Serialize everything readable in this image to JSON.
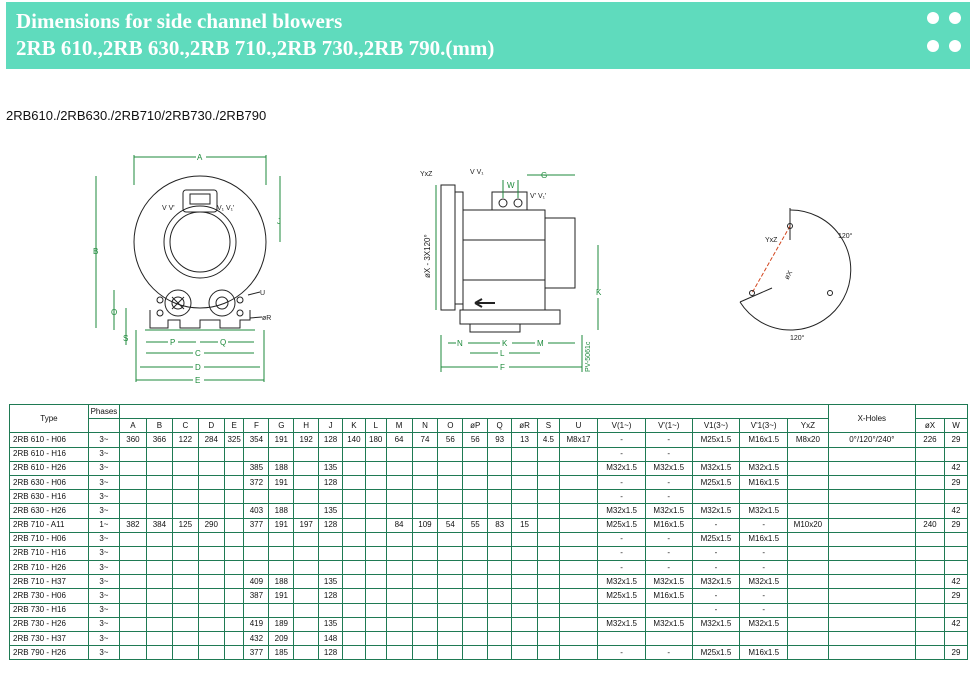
{
  "banner": {
    "title_line1": "Dimensions for side channel blowers",
    "title_line2": "2RB 610.,2RB 630.,2RB 710.,2RB 730.,2RB 790.(mm)",
    "accent_color": "#5fdbbd"
  },
  "subtitle": "2RB610./2RB630./2RB710/2RB730./2RB790",
  "drawing_labels": {
    "front": {
      "A": "A",
      "B": "B",
      "C": "C",
      "D": "D",
      "E": "E",
      "J": "J",
      "O": "O",
      "S": "S",
      "P": "P",
      "Q": "Q",
      "U": "U",
      "R": "øR",
      "V_left": "V V'",
      "V_right": "V₁ V₁'"
    },
    "side": {
      "YxZ": "YxZ",
      "VV1": "V V₁",
      "W": "W",
      "G": "G",
      "V1": "V' V₁'",
      "phiX": "øX - 3X120°",
      "K": "K",
      "N": "N",
      "L": "L",
      "M": "M",
      "F": "F",
      "PV": "PV-5061c"
    },
    "holes": {
      "YxZ": "YxZ",
      "deg_top": "120°",
      "deg_bottom": "120°",
      "phiX": "øX"
    }
  },
  "table": {
    "header": {
      "type": "Type",
      "phases": "Phases",
      "xholes": "X-Holes",
      "dims": [
        "A",
        "B",
        "C",
        "D",
        "E",
        "F",
        "G",
        "H",
        "J",
        "K",
        "L",
        "M",
        "N",
        "O",
        "øP",
        "Q",
        "øR",
        "S",
        "U",
        "V(1~)",
        "V'(1~)",
        "V1(3~)",
        "V'1(3~)",
        "YxZ"
      ],
      "phix": "øX",
      "w": "W"
    },
    "rows": [
      {
        "type": "2RB 610 - H06",
        "ph": "3~",
        "d": [
          "360",
          "366",
          "122",
          "284",
          "325",
          "354",
          "191",
          "192",
          "128",
          "140",
          "180",
          "64",
          "74",
          "56",
          "56",
          "93",
          "13",
          "4.5",
          "M8x17",
          "-",
          "-",
          "M25x1.5",
          "M16x1.5",
          "M8x20"
        ],
        "xh": "0°/120°/240°",
        "phix": "226",
        "w": "29"
      },
      {
        "type": "2RB 610 - H16",
        "ph": "3~",
        "d": [
          "",
          "",
          "",
          "",
          "",
          "",
          "",
          "",
          "",
          "",
          "",
          "",
          "",
          "",
          "",
          "",
          "",
          "",
          "",
          "-",
          "-",
          "",
          "",
          ""
        ],
        "xh": "",
        "phix": "",
        "w": ""
      },
      {
        "type": "2RB 610 - H26",
        "ph": "3~",
        "d": [
          "",
          "",
          "",
          "",
          "",
          "385",
          "188",
          "",
          "135",
          "",
          "",
          "",
          "",
          "",
          "",
          "",
          "",
          "",
          "",
          "M32x1.5",
          "M32x1.5",
          "M32x1.5",
          "M32x1.5",
          ""
        ],
        "xh": "",
        "phix": "",
        "w": "42"
      },
      {
        "type": "2RB 630 - H06",
        "ph": "3~",
        "d": [
          "",
          "",
          "",
          "",
          "",
          "372",
          "191",
          "",
          "128",
          "",
          "",
          "",
          "",
          "",
          "",
          "",
          "",
          "",
          "",
          "-",
          "-",
          "M25x1.5",
          "M16x1.5",
          ""
        ],
        "xh": "",
        "phix": "",
        "w": "29"
      },
      {
        "type": "2RB 630 - H16",
        "ph": "3~",
        "d": [
          "",
          "",
          "",
          "",
          "",
          "",
          "",
          "",
          "",
          "",
          "",
          "",
          "",
          "",
          "",
          "",
          "",
          "",
          "",
          "-",
          "-",
          "",
          "",
          ""
        ],
        "xh": "",
        "phix": "",
        "w": ""
      },
      {
        "type": "2RB 630 - H26",
        "ph": "3~",
        "d": [
          "",
          "",
          "",
          "",
          "",
          "403",
          "188",
          "",
          "135",
          "",
          "",
          "",
          "",
          "",
          "",
          "",
          "",
          "",
          "",
          "M32x1.5",
          "M32x1.5",
          "M32x1.5",
          "M32x1.5",
          ""
        ],
        "xh": "",
        "phix": "",
        "w": "42"
      },
      {
        "type": "2RB 710 - A11",
        "ph": "1~",
        "d": [
          "382",
          "384",
          "125",
          "290",
          "",
          "377",
          "191",
          "197",
          "128",
          "",
          "",
          "84",
          "109",
          "54",
          "55",
          "83",
          "15",
          "",
          "",
          "M25x1.5",
          "M16x1.5",
          "-",
          "-",
          "M10x20"
        ],
        "xh": "",
        "phix": "240",
        "w": "29"
      },
      {
        "type": "2RB 710 - H06",
        "ph": "3~",
        "d": [
          "",
          "",
          "",
          "",
          "",
          "",
          "",
          "",
          "",
          "",
          "",
          "",
          "",
          "",
          "",
          "",
          "",
          "",
          "",
          "-",
          "-",
          "M25x1.5",
          "M16x1.5",
          ""
        ],
        "xh": "",
        "phix": "",
        "w": ""
      },
      {
        "type": "2RB 710 - H16",
        "ph": "3~",
        "d": [
          "",
          "",
          "",
          "",
          "",
          "",
          "",
          "",
          "",
          "",
          "",
          "",
          "",
          "",
          "",
          "",
          "",
          "",
          "",
          "-",
          "-",
          "-",
          "-",
          ""
        ],
        "xh": "",
        "phix": "",
        "w": ""
      },
      {
        "type": "2RB 710 - H26",
        "ph": "3~",
        "d": [
          "",
          "",
          "",
          "",
          "",
          "",
          "",
          "",
          "",
          "",
          "",
          "",
          "",
          "",
          "",
          "",
          "",
          "",
          "",
          "-",
          "-",
          "-",
          "-",
          ""
        ],
        "xh": "",
        "phix": "",
        "w": ""
      },
      {
        "type": "2RB 710 - H37",
        "ph": "3~",
        "d": [
          "",
          "",
          "",
          "",
          "",
          "409",
          "188",
          "",
          "135",
          "",
          "",
          "",
          "",
          "",
          "",
          "",
          "",
          "",
          "",
          "M32x1.5",
          "M32x1.5",
          "M32x1.5",
          "M32x1.5",
          ""
        ],
        "xh": "",
        "phix": "",
        "w": "42"
      },
      {
        "type": "2RB 730 - H06",
        "ph": "3~",
        "d": [
          "",
          "",
          "",
          "",
          "",
          "387",
          "191",
          "",
          "128",
          "",
          "",
          "",
          "",
          "",
          "",
          "",
          "",
          "",
          "",
          "M25x1.5",
          "M16x1.5",
          "-",
          "-",
          ""
        ],
        "xh": "",
        "phix": "",
        "w": "29"
      },
      {
        "type": "2RB 730 - H16",
        "ph": "3~",
        "d": [
          "",
          "",
          "",
          "",
          "",
          "",
          "",
          "",
          "",
          "",
          "",
          "",
          "",
          "",
          "",
          "",
          "",
          "",
          "",
          "",
          "",
          "-",
          "-",
          ""
        ],
        "xh": "",
        "phix": "",
        "w": ""
      },
      {
        "type": "2RB 730 - H26",
        "ph": "3~",
        "d": [
          "",
          "",
          "",
          "",
          "",
          "419",
          "189",
          "",
          "135",
          "",
          "",
          "",
          "",
          "",
          "",
          "",
          "",
          "",
          "",
          "M32x1.5",
          "M32x1.5",
          "M32x1.5",
          "M32x1.5",
          ""
        ],
        "xh": "",
        "phix": "",
        "w": "42"
      },
      {
        "type": "2RB 730 - H37",
        "ph": "3~",
        "d": [
          "",
          "",
          "",
          "",
          "",
          "432",
          "209",
          "",
          "148",
          "",
          "",
          "",
          "",
          "",
          "",
          "",
          "",
          "",
          "",
          "",
          "",
          "",
          "",
          ""
        ],
        "xh": "",
        "phix": "",
        "w": ""
      },
      {
        "type": "2RB 790 - H26",
        "ph": "3~",
        "d": [
          "",
          "",
          "",
          "",
          "",
          "377",
          "185",
          "",
          "128",
          "",
          "",
          "",
          "",
          "",
          "",
          "",
          "",
          "",
          "",
          "-",
          "-",
          "M25x1.5",
          "M16x1.5",
          ""
        ],
        "xh": "",
        "phix": "",
        "w": "29"
      }
    ]
  }
}
